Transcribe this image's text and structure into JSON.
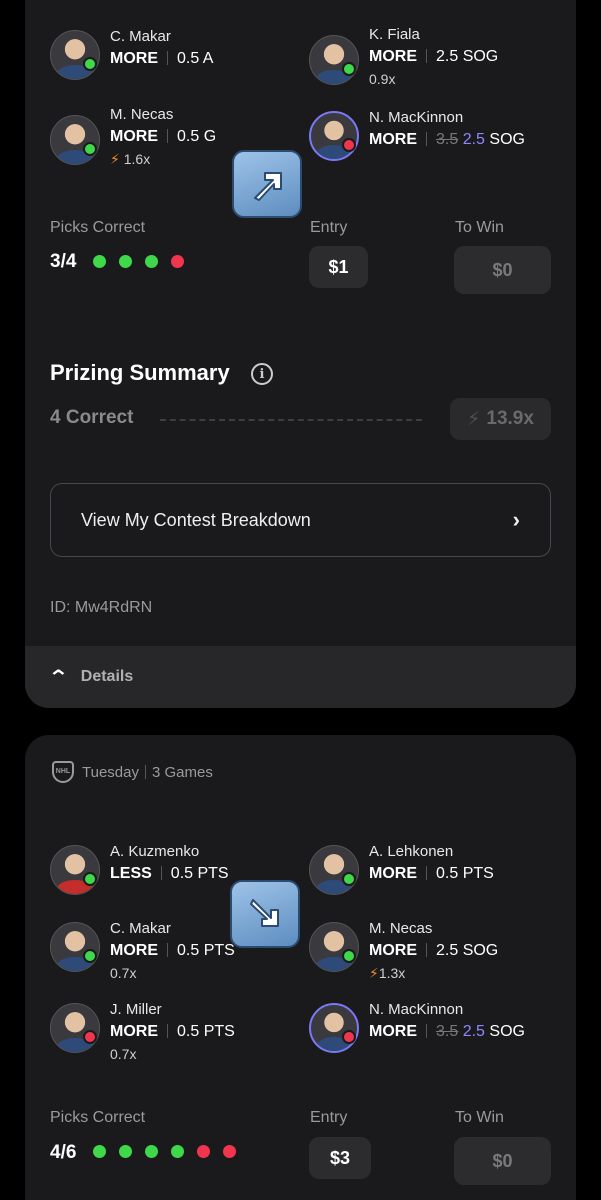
{
  "slip1": {
    "picks": [
      {
        "name": "C. Makar",
        "direction": "MORE",
        "line": "0.5 A",
        "old_line": "",
        "multiplier": "",
        "result": "hit",
        "jersey": "blue"
      },
      {
        "name": "K. Fiala",
        "direction": "MORE",
        "line": "2.5 SOG",
        "old_line": "",
        "multiplier": "0.9x",
        "result": "hit",
        "jersey": "dark"
      },
      {
        "name": "M. Necas",
        "direction": "MORE",
        "line": "0.5 G",
        "old_line": "",
        "multiplier": "1.6x",
        "result": "hit",
        "jersey": "blue",
        "boost": true
      },
      {
        "name": "N. MacKinnon",
        "direction": "MORE",
        "line": "2.5",
        "old_line": "3.5",
        "stat": "SOG",
        "multiplier": "",
        "result": "miss",
        "jersey": "blue"
      }
    ],
    "picks_correct_label": "Picks Correct",
    "picks_correct_value": "3/4",
    "pick_results": [
      "hit",
      "hit",
      "hit",
      "miss"
    ],
    "entry_label": "Entry",
    "entry_value": "$1",
    "to_win_label": "To Win",
    "to_win_value": "$0",
    "prizing_title": "Prizing Summary",
    "info_glyph": "i",
    "prize_row_label": "4 Correct",
    "prize_row_multiplier": "13.9x",
    "breakdown_label": "View My Contest Breakdown",
    "entry_id": "ID: Mw4RdRN",
    "details_label": "Details"
  },
  "slip2": {
    "league_badge": "NHL",
    "day": "Tuesday",
    "games": "3 Games",
    "picks": [
      {
        "name": "A. Kuzmenko",
        "direction": "LESS",
        "line": "0.5 PTS",
        "multiplier": ""
      },
      {
        "name": "A. Lehkonen",
        "direction": "MORE",
        "line": "0.5 PTS",
        "multiplier": ""
      },
      {
        "name": "C. Makar",
        "direction": "MORE",
        "line": "0.5 PTS",
        "multiplier": "0.7x"
      },
      {
        "name": "M. Necas",
        "direction": "MORE",
        "line": "2.5 SOG",
        "multiplier": "1.3x"
      },
      {
        "name": "J. Miller",
        "direction": "MORE",
        "line": "0.5 PTS",
        "multiplier": "0.7x"
      },
      {
        "name": "N. MacKinnon",
        "direction": "MORE",
        "line": "2.5",
        "old_line": "3.5",
        "stat": "SOG",
        "multiplier": ""
      }
    ],
    "picks_correct_label": "Picks Correct",
    "picks_correct_value": "4/6",
    "pick_results": [
      "hit",
      "hit",
      "hit",
      "hit",
      "miss",
      "miss"
    ],
    "entry_label": "Entry",
    "entry_value": "$3",
    "to_win_label": "To Win",
    "to_win_value": "$0"
  },
  "icons": {
    "bolt": "⚡",
    "chevron_right": "›",
    "chevron_up": "⌃",
    "sep": "|"
  },
  "colors": {
    "hit": "#3ed84a",
    "miss": "#f0364f",
    "accent": "#8a88ff",
    "boost": "#f08a2a"
  }
}
